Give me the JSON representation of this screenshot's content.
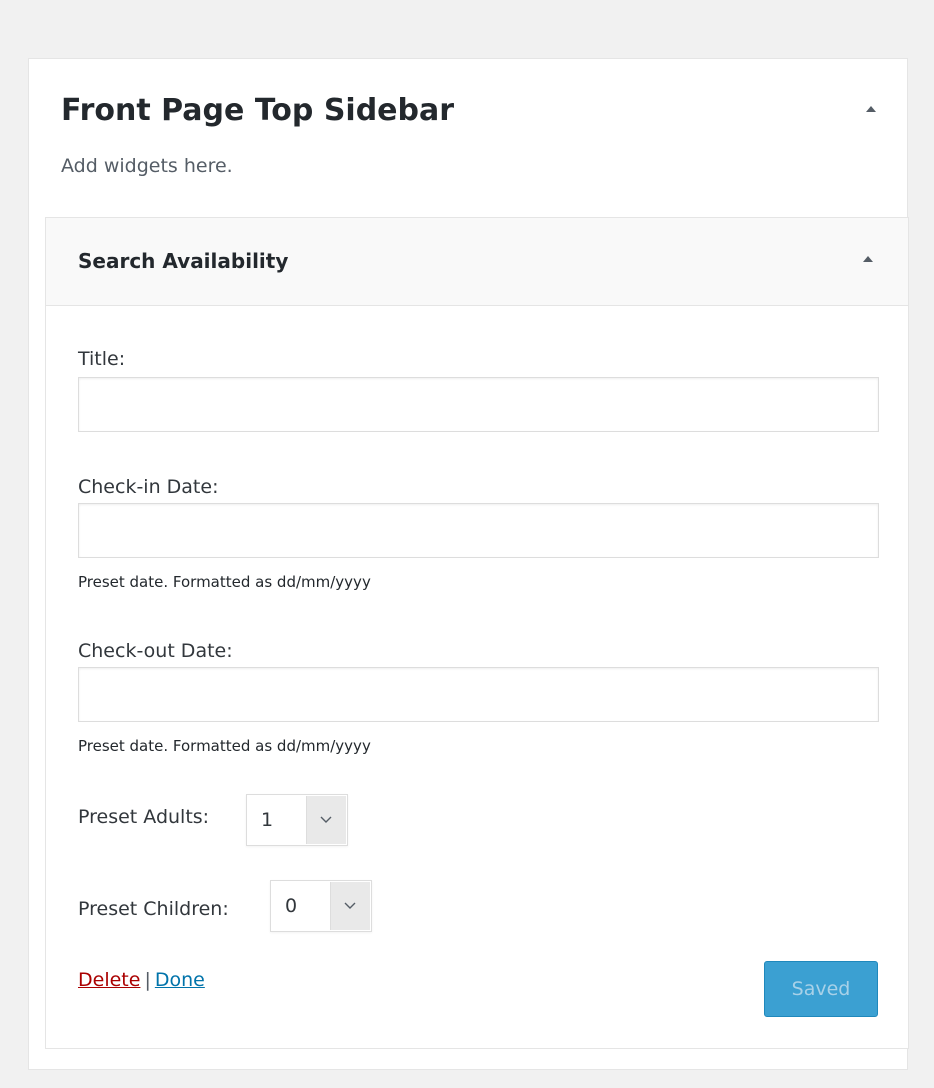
{
  "sidebar": {
    "title": "Front Page Top Sidebar",
    "description": "Add widgets here.",
    "toggle_icon": "triangle-up-icon"
  },
  "widget": {
    "title": "Search Availability",
    "toggle_icon": "triangle-up-icon",
    "fields": {
      "title": {
        "label": "Title:",
        "value": ""
      },
      "checkin": {
        "label": "Check-in Date:",
        "value": "",
        "description": "Preset date. Formatted as dd/mm/yyyy"
      },
      "checkout": {
        "label": "Check-out Date:",
        "value": "",
        "description": "Preset date. Formatted as dd/mm/yyyy"
      },
      "adults": {
        "label": "Preset Adults:",
        "value": "1"
      },
      "children": {
        "label": "Preset Children:",
        "value": "0"
      }
    },
    "actions": {
      "delete_label": "Delete",
      "separator": "|",
      "done_label": "Done",
      "save_label": "Saved"
    }
  },
  "colors": {
    "background": "#f1f1f1",
    "delete_link": "#aa0000",
    "done_link": "#0073aa",
    "save_button": "#3ba0d2"
  }
}
